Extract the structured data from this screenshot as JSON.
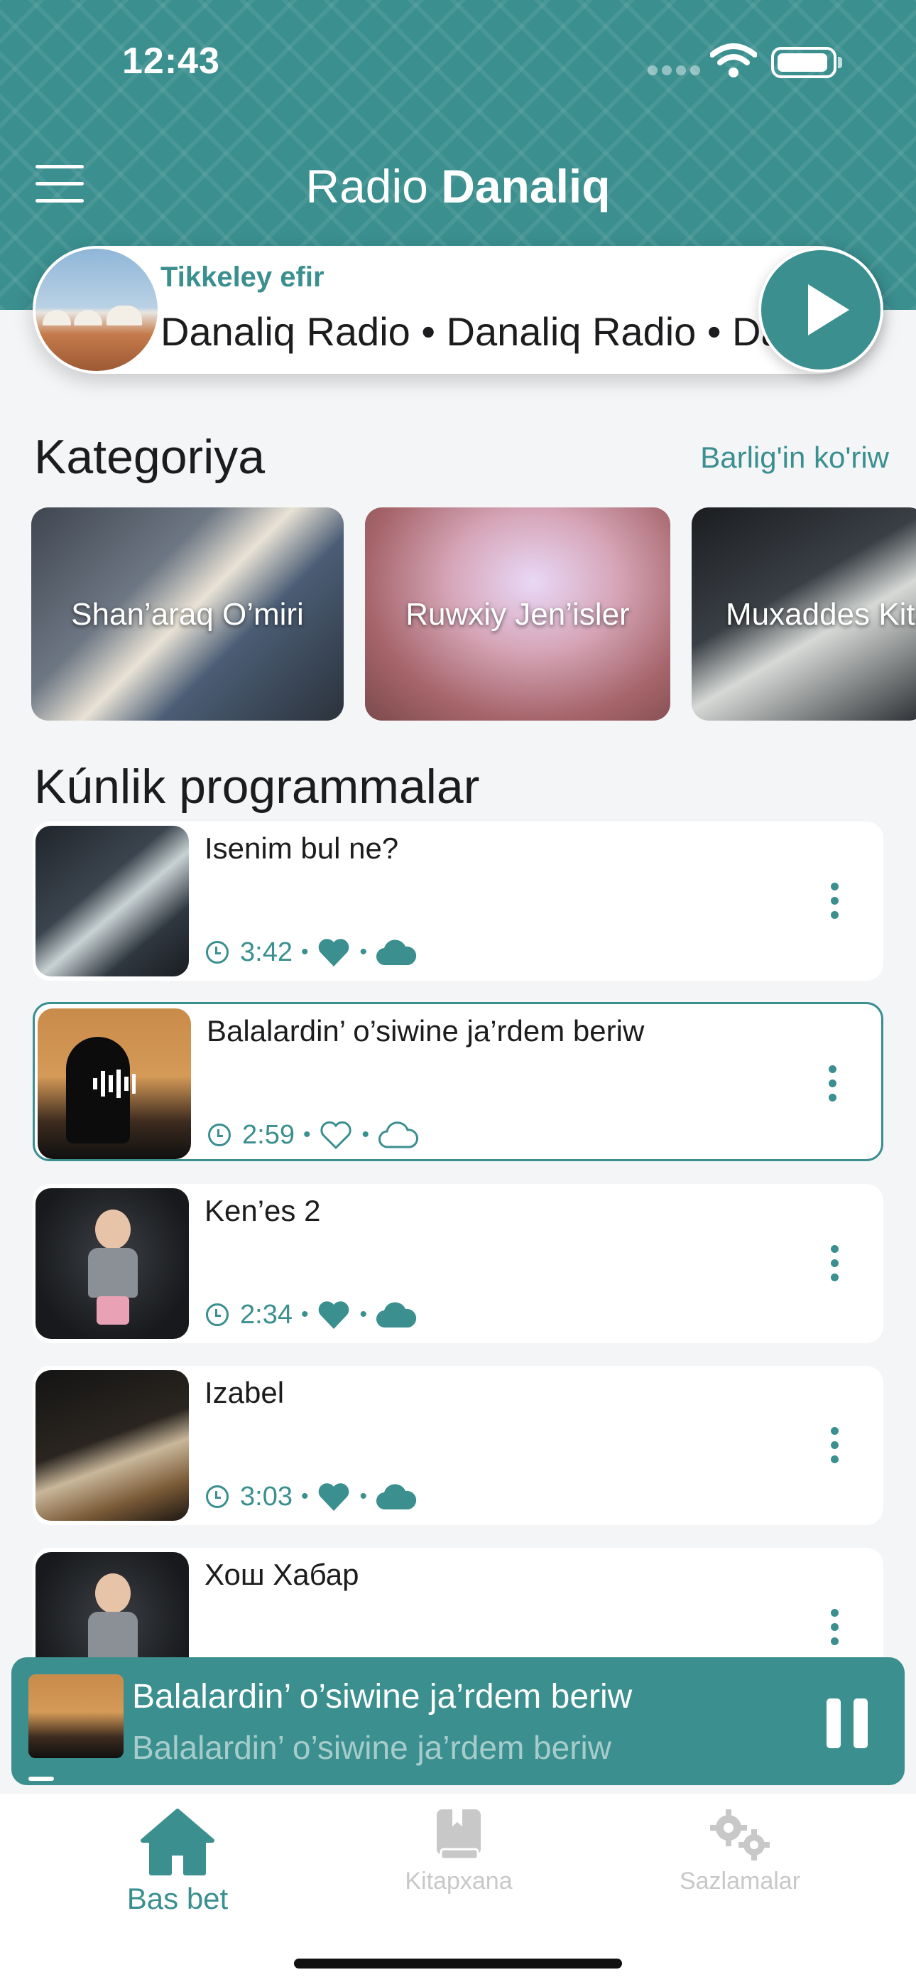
{
  "status_bar": {
    "time": "12:43"
  },
  "header": {
    "title_prefix": "Radio ",
    "title_bold": "Danaliq"
  },
  "live": {
    "label": "Tikkeley efir",
    "marquee": "Danaliq Radio • Danaliq Radio • Danaliq Radio"
  },
  "categories": {
    "title": "Kategoriya",
    "see_all": "Barlig'in ko'riw",
    "items": [
      {
        "label": "Shan’araq O’miri"
      },
      {
        "label": "Ruwxiy Jen’isler"
      },
      {
        "label": "Muxaddes Kitap"
      }
    ]
  },
  "programs": {
    "title": "Kúnlik programmalar",
    "items": [
      {
        "title": "Isenim bul ne?",
        "duration": "3:42",
        "liked": true,
        "downloaded": true
      },
      {
        "title": "Balalardin’ o’siwine ja’rdem beriw",
        "duration": "2:59",
        "liked": false,
        "downloaded": false,
        "playing": true
      },
      {
        "title": "Ken’es 2",
        "duration": "2:34",
        "liked": true,
        "downloaded": true
      },
      {
        "title": "Izabel",
        "duration": "3:03",
        "liked": true,
        "downloaded": true
      },
      {
        "title": "Хош Хабар"
      }
    ]
  },
  "mini_player": {
    "title": "Balalardin’ o’siwine ja’rdem beriw",
    "subtitle": "Balalardin’ o’siwine ja’rdem beriw"
  },
  "tabs": [
    {
      "label": "Bas bet",
      "icon": "home-icon",
      "active": true
    },
    {
      "label": "Kitapxana",
      "icon": "book-icon",
      "active": false
    },
    {
      "label": "Sazlamalar",
      "icon": "gears-icon",
      "active": false
    }
  ],
  "colors": {
    "accent": "#3b8f8f",
    "background": "#f4f5f7",
    "inactive_tab": "#c8c8c8"
  }
}
